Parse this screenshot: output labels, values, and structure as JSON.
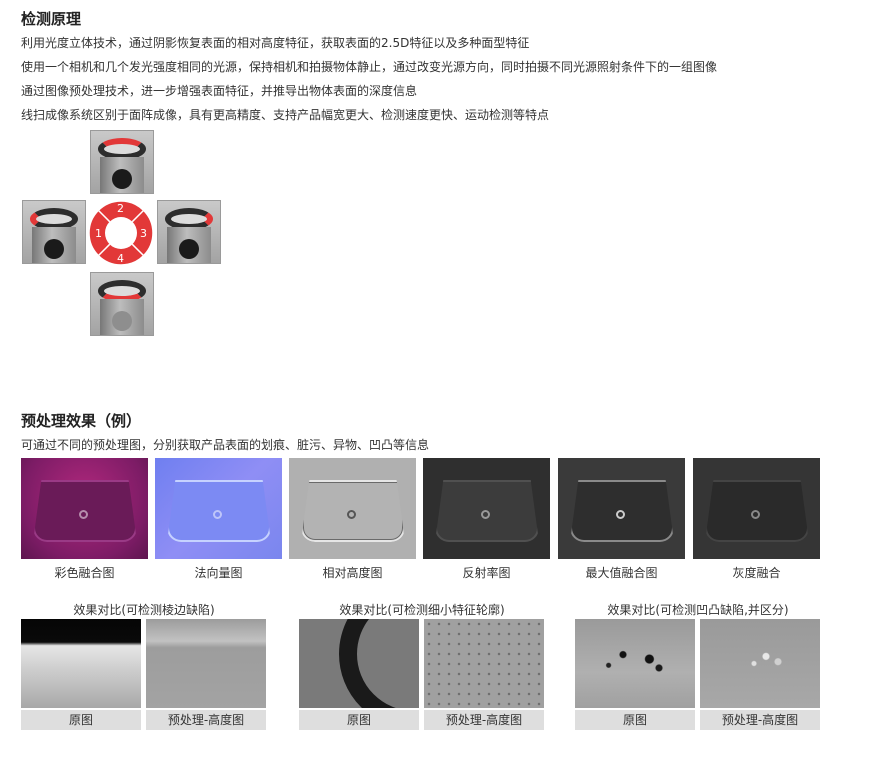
{
  "section1": {
    "title": "检测原理",
    "lines": [
      "利用光度立体技术，通过阴影恢复表面的相对高度特征，获取表面的2.5D特征以及多种面型特征",
      "使用一个相机和几个发光强度相同的光源，保持相机和拍摄物体静止，通过改变光源方向，同时拍摄不同光源照射条件下的一组图像",
      "通过图像预处理技术，进一步增强表面特征，并推导出物体表面的深度信息",
      "线扫成像系统区别于面阵成像，具有更高精度、支持产品幅宽更大、检测速度更快、运动检测等特点"
    ],
    "diagram": {
      "segments": [
        "1",
        "2",
        "3",
        "4"
      ],
      "accent_color": "#e23838"
    }
  },
  "section2": {
    "title": "预处理效果（例）",
    "subtitle": "可通过不同的预处理图，分别获取产品表面的划痕、脏污、异物、凹凸等信息",
    "images": [
      {
        "caption": "彩色融合图"
      },
      {
        "caption": "法向量图"
      },
      {
        "caption": "相对高度图"
      },
      {
        "caption": "反射率图"
      },
      {
        "caption": "最大值融合图"
      },
      {
        "caption": "灰度融合"
      }
    ]
  },
  "comparisons": [
    {
      "title": "效果对比(可检测棱边缺陷)",
      "left_label": "原图",
      "right_label": "预处理-高度图"
    },
    {
      "title": "效果对比(可检测细小特征轮廓)",
      "left_label": "原图",
      "right_label": "预处理-高度图"
    },
    {
      "title": "效果对比(可检测凹凸缺陷,并区分)",
      "left_label": "原图",
      "right_label": "预处理-高度图"
    }
  ]
}
